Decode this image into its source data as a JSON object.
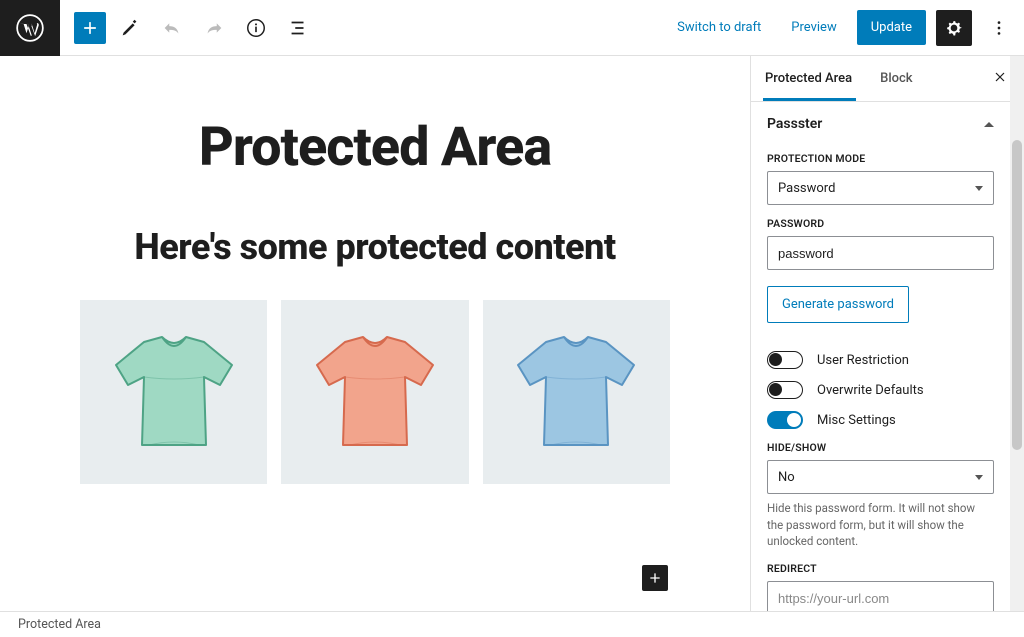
{
  "topbar": {
    "switch_to_draft": "Switch to draft",
    "preview": "Preview",
    "update": "Update"
  },
  "canvas": {
    "title": "Protected Area",
    "subtitle": "Here's some protected content",
    "tshirts": [
      {
        "color_body": "#9fd9c3",
        "color_stroke": "#4ea385"
      },
      {
        "color_body": "#f2a48c",
        "color_stroke": "#d66a4e"
      },
      {
        "color_body": "#9cc6e2",
        "color_stroke": "#5a94c2"
      }
    ]
  },
  "sidebar": {
    "tabs": {
      "protected_area": "Protected Area",
      "block": "Block"
    },
    "panel_title": "Passster",
    "protection_mode": {
      "label": "PROTECTION MODE",
      "value": "Password"
    },
    "password": {
      "label": "PASSWORD",
      "value": "password"
    },
    "generate_password": "Generate password",
    "toggles": {
      "user_restriction": {
        "label": "User Restriction",
        "on": false
      },
      "overwrite_defaults": {
        "label": "Overwrite Defaults",
        "on": false
      },
      "misc_settings": {
        "label": "Misc Settings",
        "on": true
      }
    },
    "hide_show": {
      "label": "HIDE/SHOW",
      "value": "No",
      "help": "Hide this password form. It will not show the password form, but it will show the unlocked content."
    },
    "redirect": {
      "label": "REDIRECT",
      "placeholder": "https://your-url.com"
    }
  },
  "footer": {
    "breadcrumb": "Protected Area"
  }
}
